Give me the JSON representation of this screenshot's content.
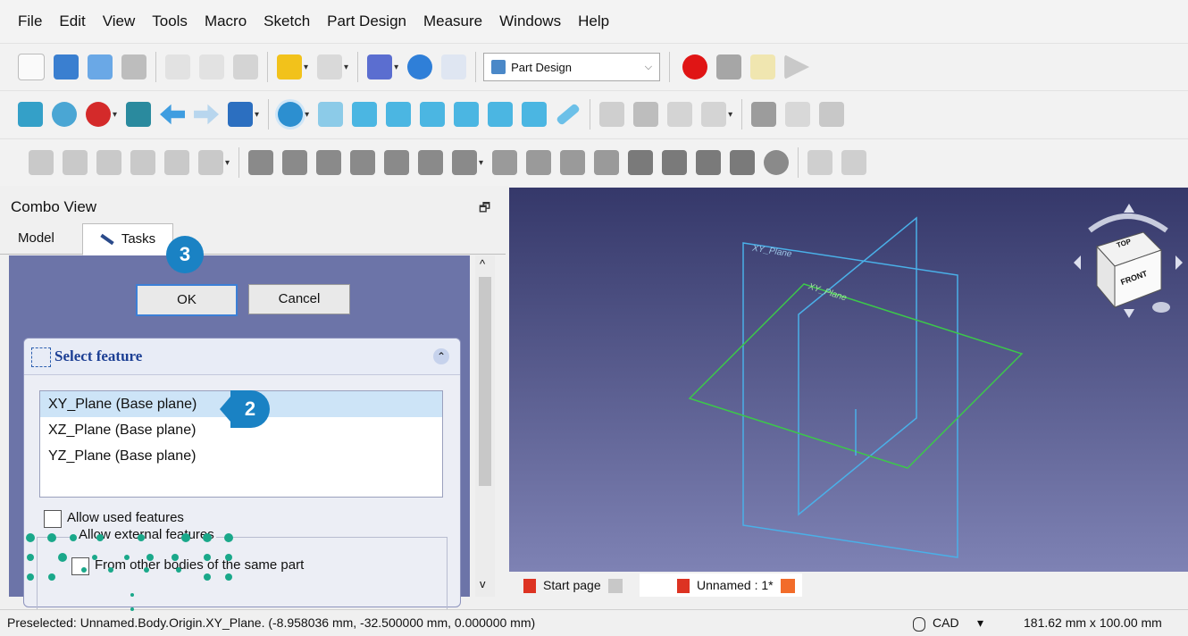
{
  "menu": [
    "File",
    "Edit",
    "View",
    "Tools",
    "Macro",
    "Sketch",
    "Part Design",
    "Measure",
    "Windows",
    "Help"
  ],
  "toolbar": {
    "workbench": "Part Design",
    "workbench_chevron": "⌵",
    "dropdown_arrow": "▾"
  },
  "combo": {
    "title": "Combo View",
    "undock_icon": "🗗",
    "tab_model": "Model",
    "tab_tasks": "Tasks"
  },
  "buttons": {
    "ok": "OK",
    "cancel": "Cancel"
  },
  "feature_box": {
    "title": "Select feature",
    "collapse_icon": "⌃",
    "items": [
      "XY_Plane (Base plane)",
      "XZ_Plane (Base plane)",
      "YZ_Plane (Base plane)"
    ]
  },
  "options": {
    "allow_used": "Allow used features",
    "allow_external": "Allow external features",
    "from_other": "From other bodies of the same part"
  },
  "scroll": {
    "up": "^",
    "down": "v"
  },
  "badges": {
    "ok": "3",
    "list": "2"
  },
  "viewport": {
    "plane_label_1": "XY_Plane",
    "plane_label_2": "XY_Plane",
    "cube_face": "FRONT",
    "cube_top": "TOP"
  },
  "doc_tabs": {
    "start": "Start page",
    "unnamed": "Unnamed : 1*"
  },
  "status": {
    "preselected": "Preselected: Unnamed.Body.Origin.XY_Plane. (-8.958036 mm, -32.500000 mm, 0.000000 mm)",
    "nav": "CAD",
    "nav_chevron": "▾",
    "dims": "181.62 mm x 100.00 mm"
  },
  "colors": {
    "badge": "#1a82c4",
    "selected_row": "#cde4f7",
    "record": "#e01515"
  }
}
